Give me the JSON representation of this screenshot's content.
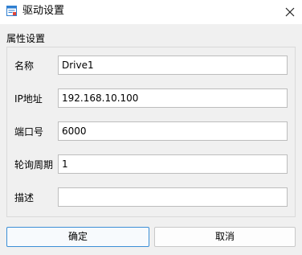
{
  "window": {
    "title": "驱动设置",
    "icon": "app-window-icon",
    "close_icon": "close-icon"
  },
  "group": {
    "label": "属性设置"
  },
  "fields": [
    {
      "label": "名称",
      "value": "Drive1"
    },
    {
      "label": "IP地址",
      "value": "192.168.10.100"
    },
    {
      "label": "端口号",
      "value": "6000"
    },
    {
      "label": "轮询周期",
      "value": "1"
    },
    {
      "label": "描述",
      "value": ""
    }
  ],
  "buttons": {
    "ok_label": "确定",
    "cancel_label": "取消"
  },
  "colors": {
    "accent": "#3c8fd6",
    "icon_red": "#e0463b",
    "icon_blue": "#2f7fd1"
  }
}
